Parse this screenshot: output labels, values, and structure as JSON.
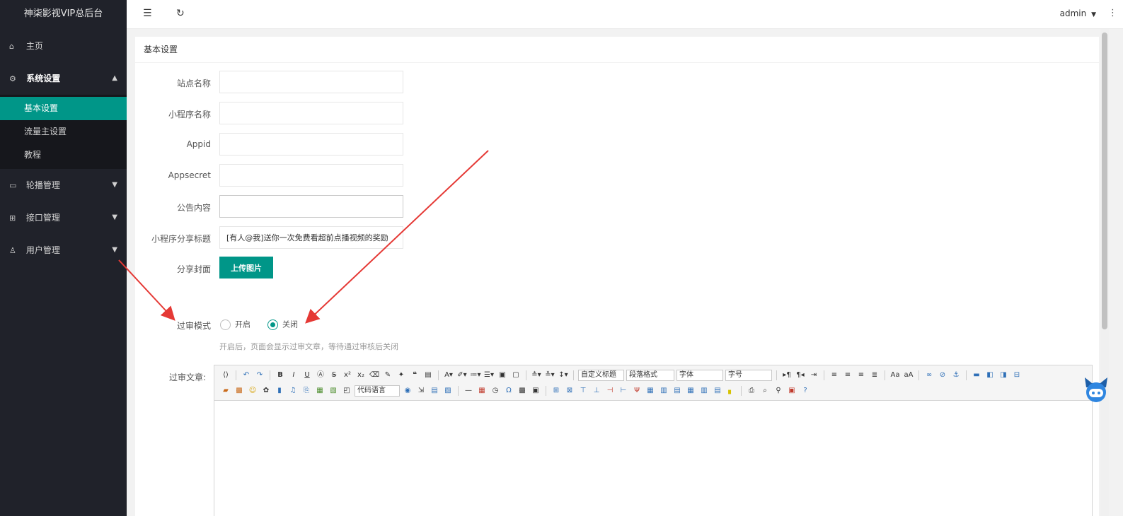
{
  "app": {
    "title": "神柒影视VIP总后台"
  },
  "header": {
    "user": "admin",
    "user_caret": "▼",
    "more_icon": "⋮"
  },
  "sidebar": {
    "home": {
      "icon": "home-icon",
      "label": "主页"
    },
    "system": {
      "icon": "gear-icon",
      "label": "系统设置",
      "expanded": true,
      "children": [
        {
          "label": "基本设置",
          "active": true
        },
        {
          "label": "流量主设置",
          "active": false
        },
        {
          "label": "教程",
          "active": false
        }
      ]
    },
    "carousel": {
      "icon": "image-icon",
      "label": "轮播管理"
    },
    "api": {
      "icon": "plugin-icon",
      "label": "接口管理"
    },
    "users": {
      "icon": "user-icon",
      "label": "用户管理"
    }
  },
  "card": {
    "title": "基本设置"
  },
  "form": {
    "site_name": {
      "label": "站点名称",
      "value": ""
    },
    "mini_name": {
      "label": "小程序名称",
      "value": ""
    },
    "appid": {
      "label": "Appid",
      "value": ""
    },
    "appsecret": {
      "label": "Appsecret",
      "value": ""
    },
    "notice": {
      "label": "公告内容",
      "value": ""
    },
    "share_title": {
      "label": "小程序分享标题",
      "value": "[有人@我]送你一次免费看超前点播视频的奖励"
    },
    "share_cover": {
      "label": "分享封面",
      "button": "上传图片"
    },
    "review_mode": {
      "label": "过审模式",
      "options": [
        {
          "label": "开启",
          "checked": false
        },
        {
          "label": "关闭",
          "checked": true
        }
      ],
      "hint": "开启后，页面会显示过审文章，等待通过审核后关闭"
    },
    "review_article": {
      "label": "过审文章:"
    }
  },
  "editor": {
    "selects": {
      "code_lang": "代码语言",
      "custom_title": "自定义标题",
      "paragraph": "段落格式",
      "font": "字体",
      "font_size": "字号"
    }
  },
  "colors": {
    "accent": "#009688",
    "sidebar_bg": "#20222a",
    "arrow": "#e53935"
  }
}
